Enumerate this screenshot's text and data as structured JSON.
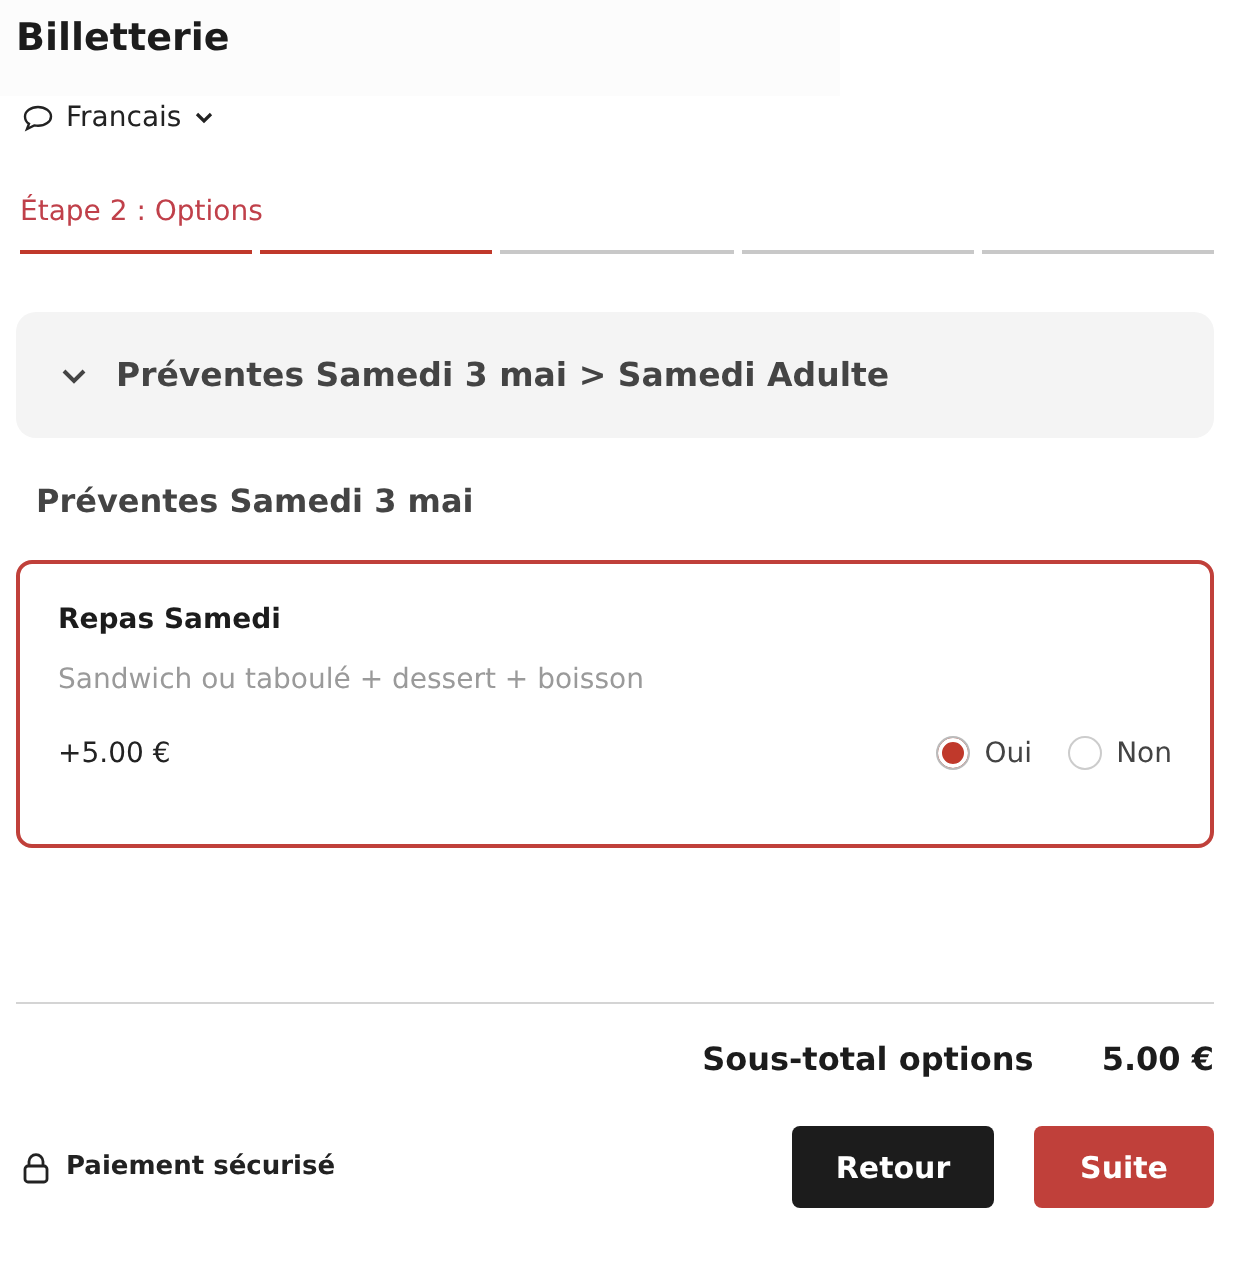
{
  "title": "Billetterie",
  "language": {
    "label": "Francais"
  },
  "step": {
    "label": "Étape 2 : Options",
    "segments": [
      {
        "done": true
      },
      {
        "done": true
      },
      {
        "done": false
      },
      {
        "done": false
      },
      {
        "done": false
      }
    ]
  },
  "accordion": {
    "title": "Préventes Samedi 3 mai > Samedi Adulte",
    "expanded": true
  },
  "section_title": "Préventes Samedi 3 mai",
  "option": {
    "name": "Repas Samedi",
    "description": "Sandwich ou taboulé + dessert + boisson",
    "price": "+5.00 €",
    "choices": [
      {
        "label": "Oui",
        "selected": true
      },
      {
        "label": "Non",
        "selected": false
      }
    ]
  },
  "subtotal": {
    "label": "Sous-total options",
    "value": "5.00 €"
  },
  "secure_label": "Paiement sécurisé",
  "buttons": [
    {
      "label": "Retour",
      "kind": "secondary"
    },
    {
      "label": "Suite",
      "kind": "primary"
    }
  ]
}
